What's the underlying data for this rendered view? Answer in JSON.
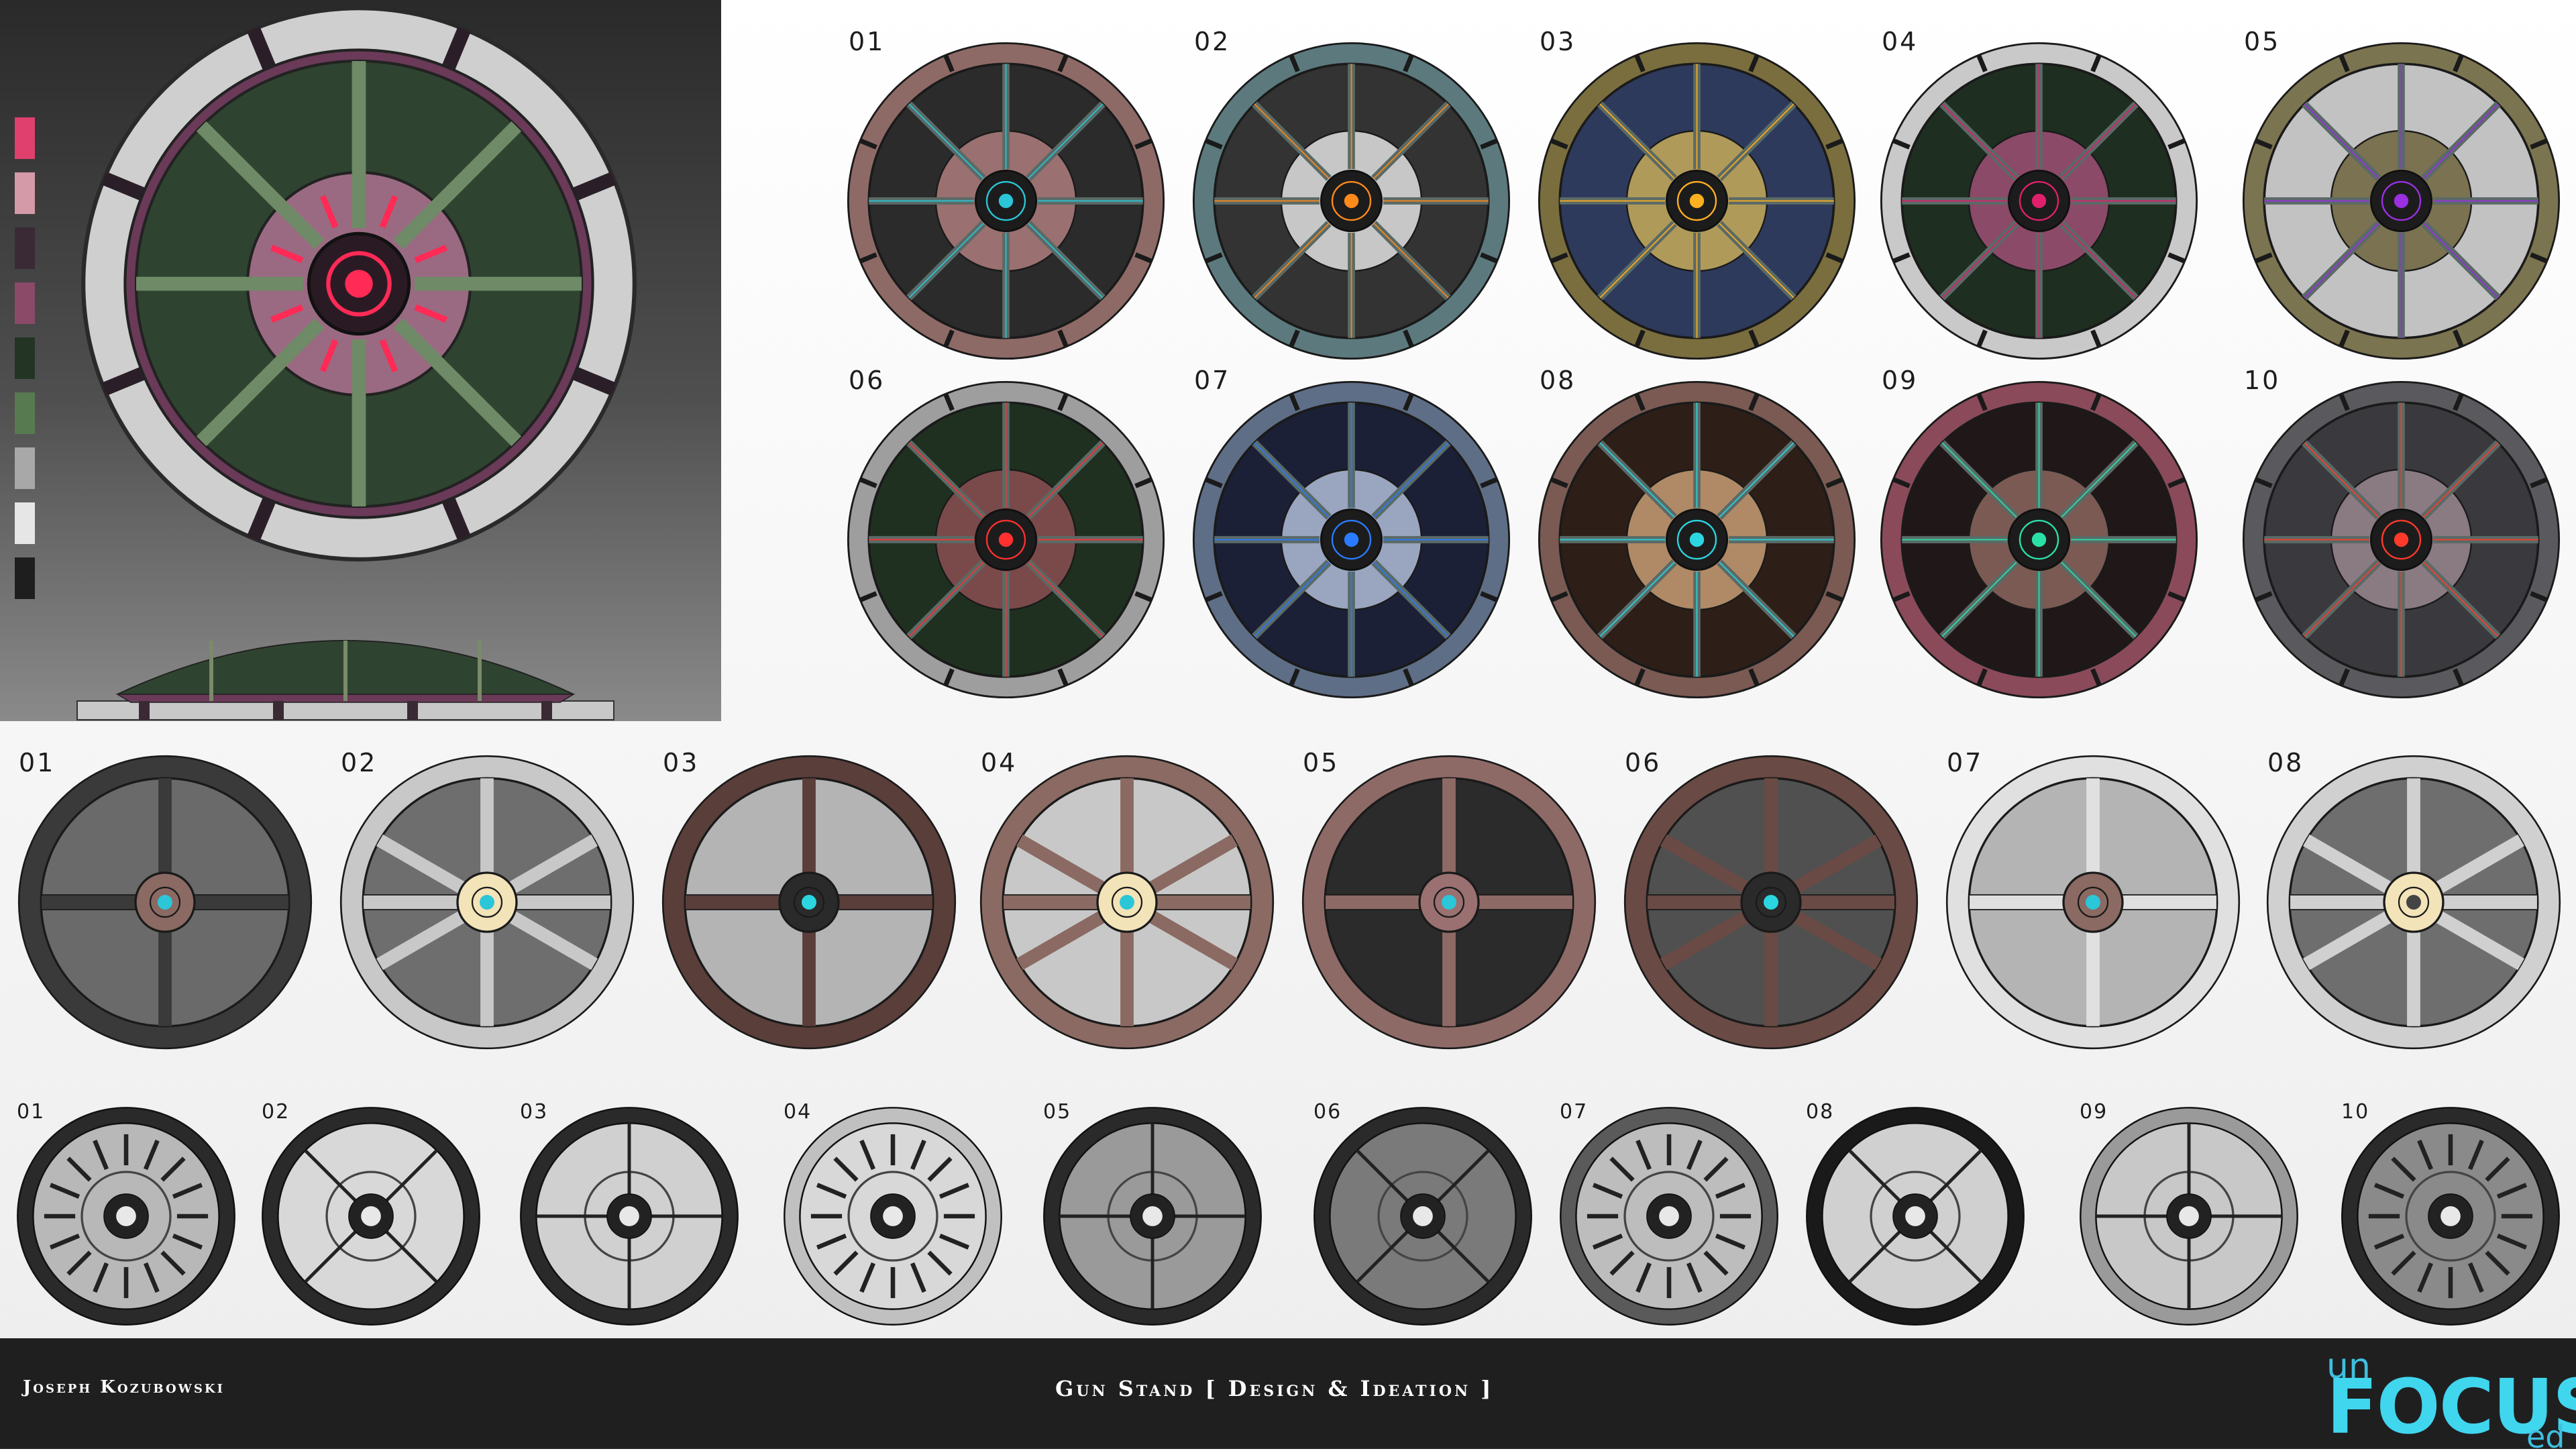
{
  "palette": {
    "swatches": [
      "#e0406e",
      "#d49aa8",
      "#3a2a36",
      "#8a4a68",
      "#243424",
      "#587a50",
      "#a8a8a8",
      "#e6e6e6",
      "#1e1e1e"
    ]
  },
  "hero": {
    "glow": "#ff2a55",
    "frame": "#c9c9c9",
    "body": "#2f4430"
  },
  "row_a": {
    "items": [
      {
        "label": "01",
        "rim": "#8e6a66",
        "fill": "#2b2b2b",
        "hub": "#9a7070",
        "accent": "#2bc6d8"
      },
      {
        "label": "02",
        "rim": "#5c7a7e",
        "fill": "#333333",
        "hub": "#c7c7c7",
        "accent": "#ff8a1a"
      },
      {
        "label": "03",
        "rim": "#7a6e3e",
        "fill": "#2e3a5c",
        "hub": "#b09a5a",
        "accent": "#ffb020"
      },
      {
        "label": "04",
        "rim": "#c9c9c9",
        "fill": "#1e2e20",
        "hub": "#8a4a68",
        "accent": "#e0206a"
      },
      {
        "label": "05",
        "rim": "#7b7450",
        "fill": "#c2c2c2",
        "hub": "#7a7250",
        "accent": "#9a30e0"
      },
      {
        "label": "06",
        "rim": "#9e9e9e",
        "fill": "#1f3020",
        "hub": "#7a4a4a",
        "accent": "#ff3030"
      },
      {
        "label": "07",
        "rim": "#5e6e86",
        "fill": "#1c2036",
        "hub": "#9aa6c0",
        "accent": "#2a7bff"
      },
      {
        "label": "08",
        "rim": "#7a5a52",
        "fill": "#2e1e18",
        "hub": "#b08a66",
        "accent": "#2bd6e0"
      },
      {
        "label": "09",
        "rim": "#8a4a5a",
        "fill": "#201818",
        "hub": "#7a5a52",
        "accent": "#2be0a8"
      },
      {
        "label": "10",
        "rim": "#5a5a5e",
        "fill": "#3a3a3e",
        "hub": "#8a7a82",
        "accent": "#ff3a2a"
      }
    ]
  },
  "row_b": {
    "items": [
      {
        "label": "01",
        "rim": "#3a3a3a",
        "fill": "#6a6a6a",
        "hub": "#8a6a62",
        "accent": "#2bc6d8"
      },
      {
        "label": "02",
        "rim": "#c8c8c8",
        "fill": "#6e6e6e",
        "hub": "#f3e3b8",
        "accent": "#2bc6d8"
      },
      {
        "label": "03",
        "rim": "#5a3e3a",
        "fill": "#b4b4b4",
        "hub": "#2a2a2a",
        "accent": "#2bd6e0"
      },
      {
        "label": "04",
        "rim": "#8a6a62",
        "fill": "#c8c8c8",
        "hub": "#f3e3b8",
        "accent": "#2bc6d8"
      },
      {
        "label": "05",
        "rim": "#8e6a66",
        "fill": "#2b2b2b",
        "hub": "#9a7070",
        "accent": "#2bc6d8"
      },
      {
        "label": "06",
        "rim": "#6a4a44",
        "fill": "#505050",
        "hub": "#2a2a2a",
        "accent": "#2bd6e0"
      },
      {
        "label": "07",
        "rim": "#e0e0e0",
        "fill": "#b4b4b4",
        "hub": "#8a6a62",
        "accent": "#2bc6d8"
      },
      {
        "label": "08",
        "rim": "#d0d0d0",
        "fill": "#6e6e6e",
        "hub": "#f3e3b8",
        "accent": "#444444"
      }
    ]
  },
  "row_c": {
    "items": [
      {
        "label": "01",
        "rim": "#2a2a2a",
        "fill": "#b8b8b8"
      },
      {
        "label": "02",
        "rim": "#2a2a2a",
        "fill": "#d8d8d8"
      },
      {
        "label": "03",
        "rim": "#2a2a2a",
        "fill": "#d0d0d0"
      },
      {
        "label": "04",
        "rim": "#c0c0c0",
        "fill": "#d8d8d8"
      },
      {
        "label": "05",
        "rim": "#2a2a2a",
        "fill": "#9a9a9a"
      },
      {
        "label": "06",
        "rim": "#2a2a2a",
        "fill": "#7a7a7a"
      },
      {
        "label": "07",
        "rim": "#5a5a5a",
        "fill": "#bdbdbd"
      },
      {
        "label": "08",
        "rim": "#1a1a1a",
        "fill": "#d0d0d0"
      },
      {
        "label": "09",
        "rim": "#9a9a9a",
        "fill": "#c8c8c8"
      },
      {
        "label": "10",
        "rim": "#2a2a2a",
        "fill": "#8a8a8a"
      }
    ]
  },
  "footer": {
    "author": "Joseph Kozubowski",
    "title": "Gun Stand [ Design & Ideation ]",
    "logo_top": "un",
    "logo_main": "FOCUS",
    "logo_bottom": "ed"
  }
}
